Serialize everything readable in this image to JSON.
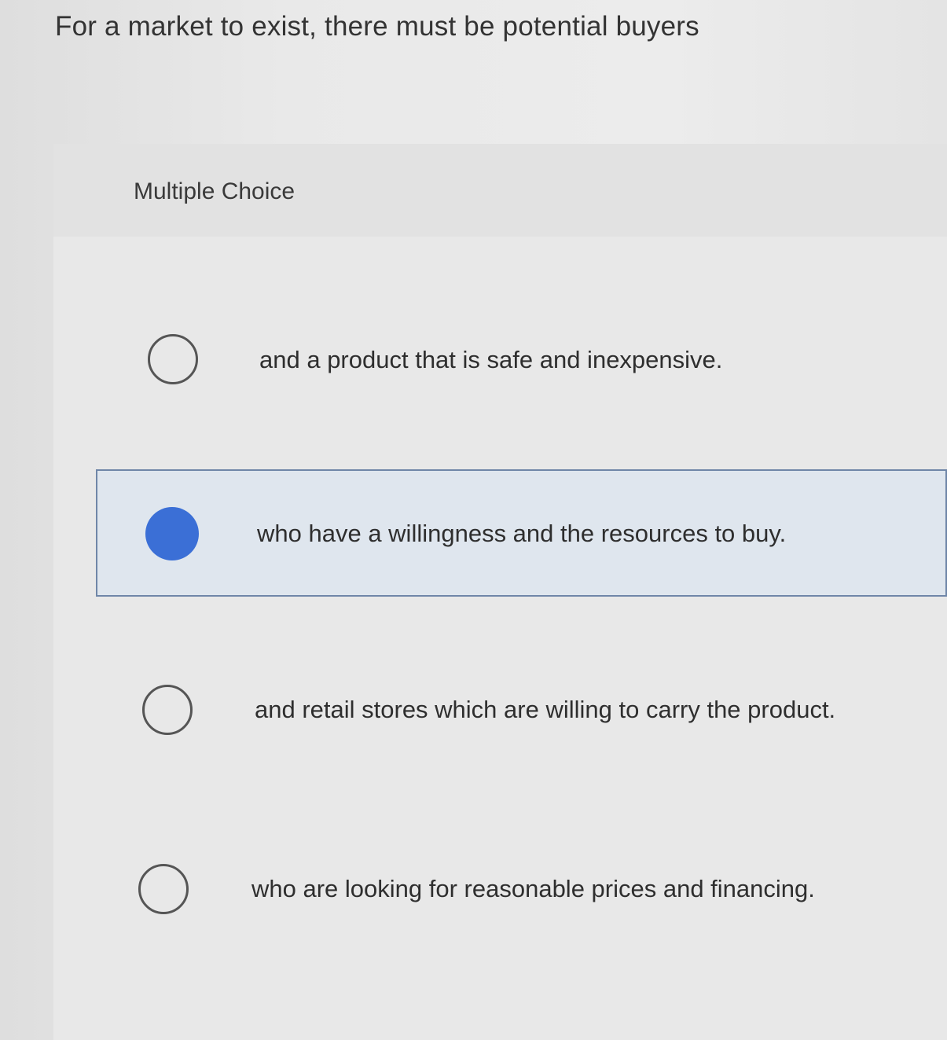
{
  "question": {
    "text": "For a market to exist, there must be potential buyers"
  },
  "multiple_choice": {
    "label": "Multiple Choice",
    "selected_index": 1,
    "options": [
      {
        "text": "and a product that is safe and inexpensive.",
        "selected": false
      },
      {
        "text": "who have a willingness and the resources to buy.",
        "selected": true
      },
      {
        "text": "and retail stores which are willing to carry the product.",
        "selected": false
      },
      {
        "text": "who are looking for reasonable prices and financing.",
        "selected": false
      }
    ]
  },
  "colors": {
    "selected_radio": "#3b6fd6",
    "selected_background": "#dfe6ee",
    "selected_border": "#6f86a8"
  }
}
